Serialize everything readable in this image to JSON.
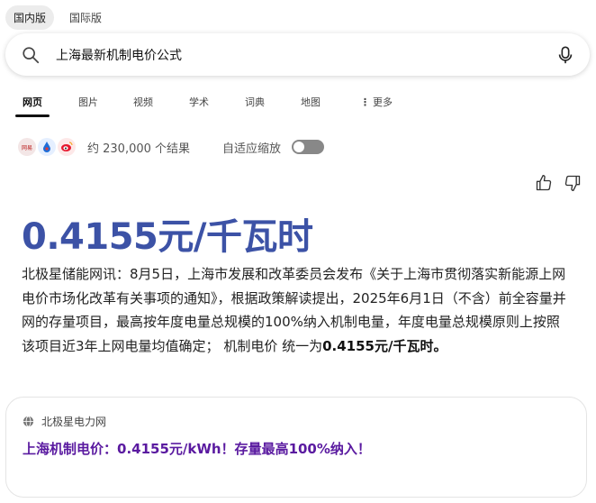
{
  "region_tabs": [
    {
      "label": "国内版",
      "active": true
    },
    {
      "label": "国际版",
      "active": false
    }
  ],
  "search": {
    "query": "上海最新机制电价公式"
  },
  "nav_tabs": [
    {
      "label": "网页",
      "active": true
    },
    {
      "label": "图片",
      "active": false
    },
    {
      "label": "视频",
      "active": false
    },
    {
      "label": "学术",
      "active": false
    },
    {
      "label": "词典",
      "active": false
    },
    {
      "label": "地图",
      "active": false
    },
    {
      "label": "更多",
      "active": false
    }
  ],
  "meta": {
    "source_icon_1_text": "网易",
    "result_count": "约 230,000 个结果",
    "adaptive_label": "自适应缩放",
    "adaptive_on": false
  },
  "answer": {
    "highlight": "0.4155元/千瓦时",
    "text_part1": "北极星储能网讯：8月5日，上海市发展和改革委员会发布《关于上海市贯彻落实新能源上网电价市场化改革有关事项的通知》，根据政策解读提出，2025年6月1日（不含）前全容量并网的存量项目，最高按年度电量总规模的100%纳入机制电量，年度电量总规模原则上按照该项目近3年上网电量均值确定； 机制电价 统一为",
    "text_bold": "0.4155元/千瓦时。"
  },
  "source_card": {
    "site": "北极星电力网",
    "title": "上海机制电价：0.4155元/kWh！存量最高100%纳入！"
  },
  "colors": {
    "answer_blue": "#3c52a6",
    "link_purple": "#5a1aa0"
  }
}
